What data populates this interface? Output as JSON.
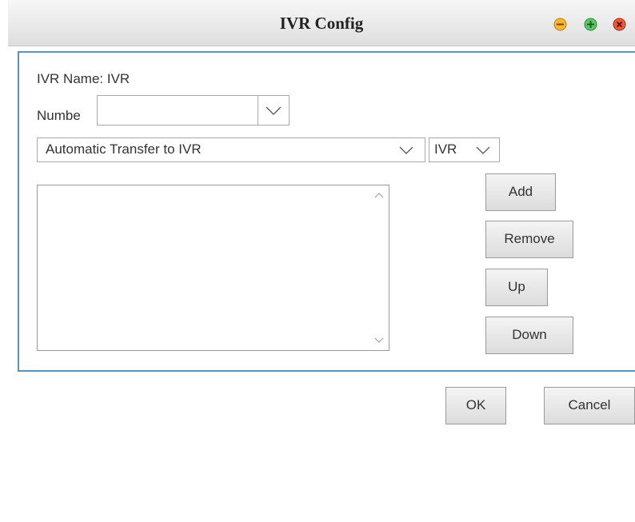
{
  "window": {
    "title": "IVR Config"
  },
  "form": {
    "ivr_name_label": "IVR Name: IVR",
    "number_label": "Numbe",
    "number_value": "",
    "transfer_selected": "Automatic Transfer to IVR",
    "target_selected": "IVR"
  },
  "list": {
    "items": []
  },
  "buttons": {
    "add": "Add",
    "remove": "Remove",
    "up": "Up",
    "down": "Down",
    "ok": "OK",
    "cancel": "Cancel"
  },
  "colors": {
    "panel_border": "#5c93b4",
    "minimize": "#f2a51a",
    "maximize": "#3bb54a",
    "close": "#e0452f"
  }
}
